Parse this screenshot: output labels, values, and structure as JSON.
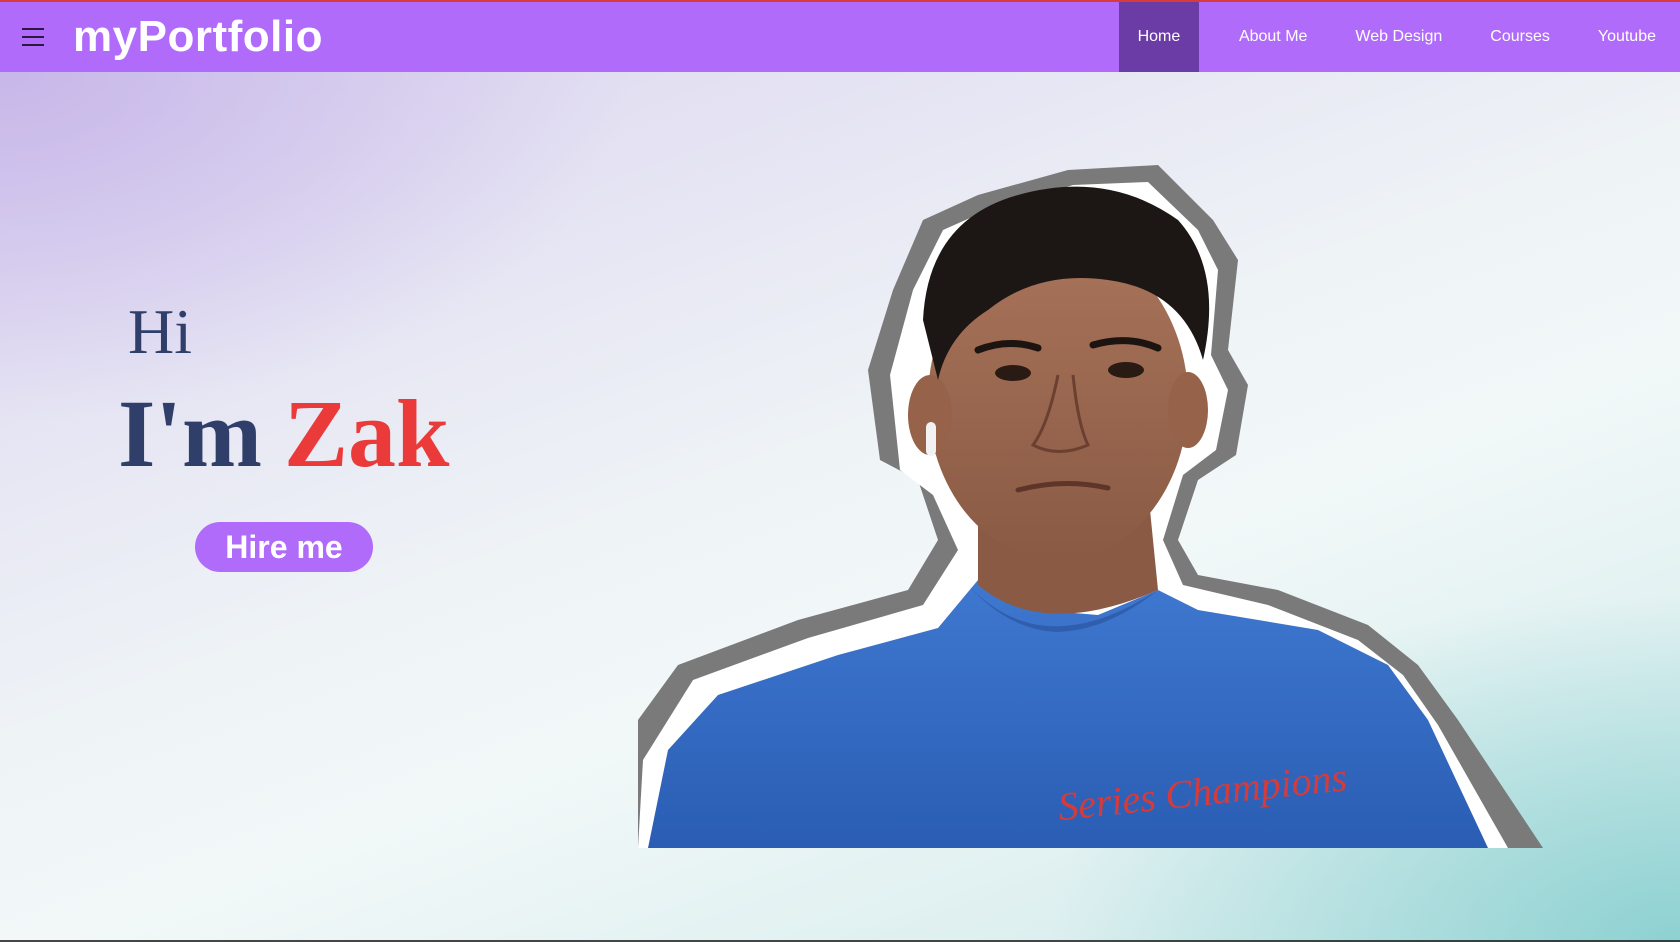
{
  "brand": {
    "title": "myPortfolio"
  },
  "nav": {
    "items": [
      {
        "label": "Home",
        "active": true
      },
      {
        "label": "About Me",
        "active": false
      },
      {
        "label": "Web Design",
        "active": false
      },
      {
        "label": "Courses",
        "active": false
      },
      {
        "label": "Youtube",
        "active": false
      }
    ]
  },
  "hero": {
    "greeting": "Hi",
    "intro": "I'm",
    "name": "Zak",
    "cta_label": "Hire me",
    "photo_subject": "portrait-photo",
    "shirt_text": "Series Champions"
  },
  "colors": {
    "nav_bg": "#b06bfb",
    "nav_active_bg": "#6b3ba6",
    "heading_color": "#2f3f6a",
    "name_color": "#ea3a3a",
    "cta_bg": "#b06bfb"
  }
}
